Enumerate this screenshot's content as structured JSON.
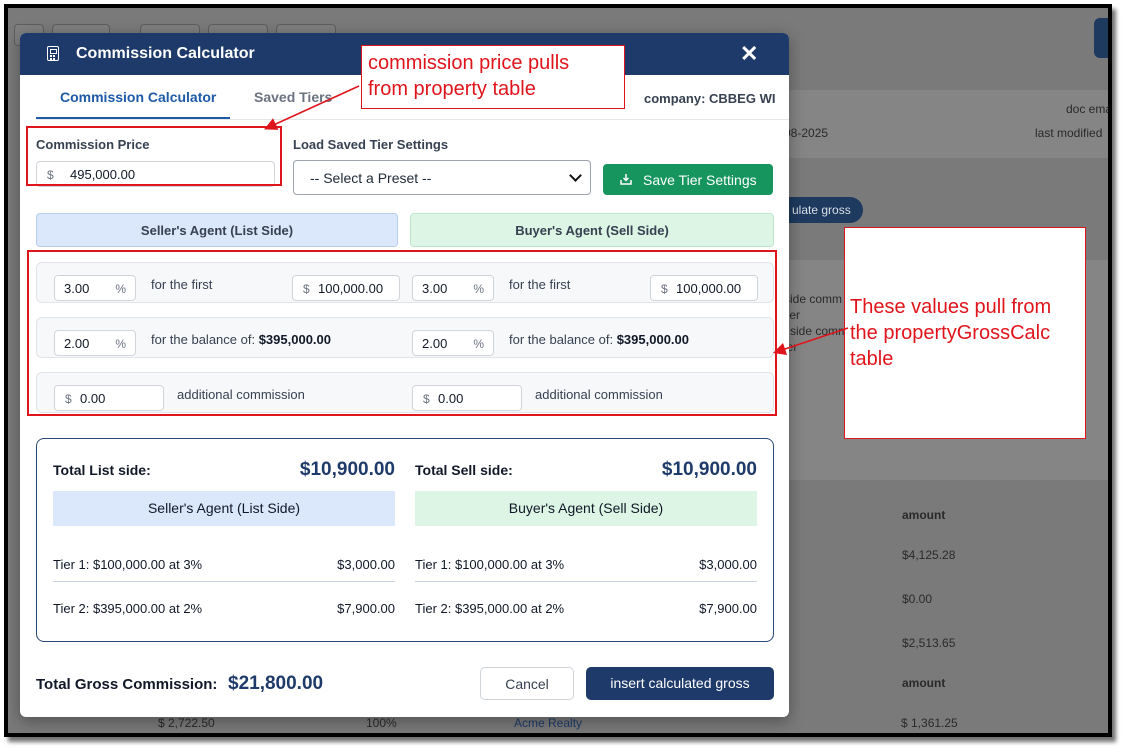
{
  "background": {
    "date_text": "08-2025",
    "doc_email_label": "doc ema",
    "last_modified_label": "last modified",
    "calc_gross_button": "ulate gross",
    "side_lines": [
      "side comm",
      "ller",
      "l side comm",
      "ler"
    ],
    "amount_header": "amount",
    "amounts": [
      "$4,125.28",
      "$0.00",
      "$2,513.65"
    ],
    "amount_header_2": "amount",
    "bottom_left_amount": "$ 2,722.50",
    "bottom_percent": "100%",
    "bottom_company": "Acme Realty",
    "bottom_right_amount": "$ 1,361.25",
    "letter_fragment": "g"
  },
  "modal": {
    "title": "Commission Calculator",
    "close_label": "✕",
    "tabs": [
      {
        "label": "Commission Calculator",
        "active": true
      },
      {
        "label": "Saved Tiers",
        "active": false
      }
    ],
    "company_text": "company: CBBEG WI",
    "commission_price": {
      "label": "Commission Price",
      "prefix": "$",
      "value": "495,000.00"
    },
    "load_saved": {
      "label": "Load Saved Tier Settings",
      "selected": "-- Select a Preset --"
    },
    "save_button": "Save Tier Settings",
    "list_side_header": "Seller's Agent (List Side)",
    "sell_side_header": "Buyer's Agent (Sell Side)",
    "list": {
      "tier1_rate": "3.00",
      "tier1_text": "for the first",
      "tier1_amount": "100,000.00",
      "tier2_rate": "2.00",
      "tier2_text": "for the balance of:",
      "tier2_balance": "$395,000.00",
      "additional_value": "0.00",
      "additional_text": "additional commission"
    },
    "sell": {
      "tier1_rate": "3.00",
      "tier1_text": "for the first",
      "tier1_amount": "100,000.00",
      "tier2_rate": "2.00",
      "tier2_text": "for the balance of:",
      "tier2_balance": "$395,000.00",
      "additional_value": "0.00",
      "additional_text": "additional commission"
    },
    "percent_symbol": "%",
    "dollar_symbol": "$",
    "summary": {
      "list_label": "Total List side:",
      "list_total": "$10,900.00",
      "sell_label": "Total Sell side:",
      "sell_total": "$10,900.00",
      "list_band": "Seller's Agent (List Side)",
      "sell_band": "Buyer's Agent (Sell Side)",
      "list_tiers": [
        {
          "label": "Tier 1: $100,000.00 at 3%",
          "amount": "$3,000.00"
        },
        {
          "label": "Tier 2: $395,000.00 at 2%",
          "amount": "$7,900.00"
        }
      ],
      "sell_tiers": [
        {
          "label": "Tier 1: $100,000.00 at 3%",
          "amount": "$3,000.00"
        },
        {
          "label": "Tier 2: $395,000.00 at 2%",
          "amount": "$7,900.00"
        }
      ]
    },
    "gross_label": "Total Gross Commission:",
    "gross_total": "$21,800.00",
    "cancel_button": "Cancel",
    "insert_button": "insert calculated gross"
  },
  "annotations": {
    "price_note": [
      "commission price pulls",
      "from property table"
    ],
    "values_note": [
      "These values pull from",
      "the propertyGrossCalc",
      "table"
    ]
  },
  "colors": {
    "header_navy": "#1e3a6a",
    "save_green": "#16955e",
    "annotation_red": "#e0141b"
  }
}
